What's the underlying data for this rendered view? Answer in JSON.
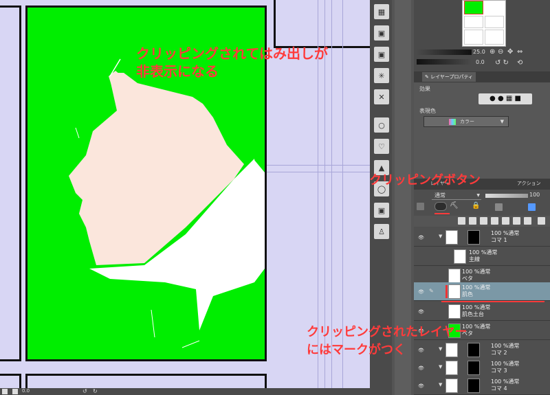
{
  "annotations": {
    "top_line1": "クリッピングされてはみ出しが",
    "top_line2": "非表示になる",
    "button_note": "クリッピングボタン",
    "mark_line1": "クリッピングされたレイヤー",
    "mark_line2": "にはマークがつく"
  },
  "navigator": {
    "zoom_value": "25.0",
    "rotate_value": "0.0"
  },
  "property_panel": {
    "tab_label": "レイヤープロパティ",
    "effect_label": "効果",
    "expression_color_label": "表現色",
    "color_value": "カラー"
  },
  "layer_panel": {
    "tab_label": "レイヤー",
    "tab_action": "アクション",
    "blend_mode": "通常",
    "opacity": "100",
    "layers": [
      {
        "opacity_mode": "100 %通常",
        "name": "コマ 1"
      },
      {
        "opacity_mode": "100 %通常",
        "name": "主線"
      },
      {
        "opacity_mode": "100 %通常",
        "name": "ベタ"
      },
      {
        "opacity_mode": "100 %通常",
        "name": "肌色"
      },
      {
        "opacity_mode": "100 %通常",
        "name": "肌色土台"
      },
      {
        "opacity_mode": "100 %通常",
        "name": "ベタ"
      },
      {
        "opacity_mode": "100 %通常",
        "name": "コマ 2"
      },
      {
        "opacity_mode": "100 %通常",
        "name": "コマ 3"
      },
      {
        "opacity_mode": "100 %通常",
        "name": "コマ 4"
      }
    ]
  },
  "status_bar": {
    "zoom": "0.0"
  },
  "colors": {
    "annotation": "#ff3b3b",
    "canvas_bg": "#d8d6f4",
    "fill_green": "#00ee00",
    "skin": "#fbe6dc",
    "selected_layer": "#7b98a6"
  }
}
